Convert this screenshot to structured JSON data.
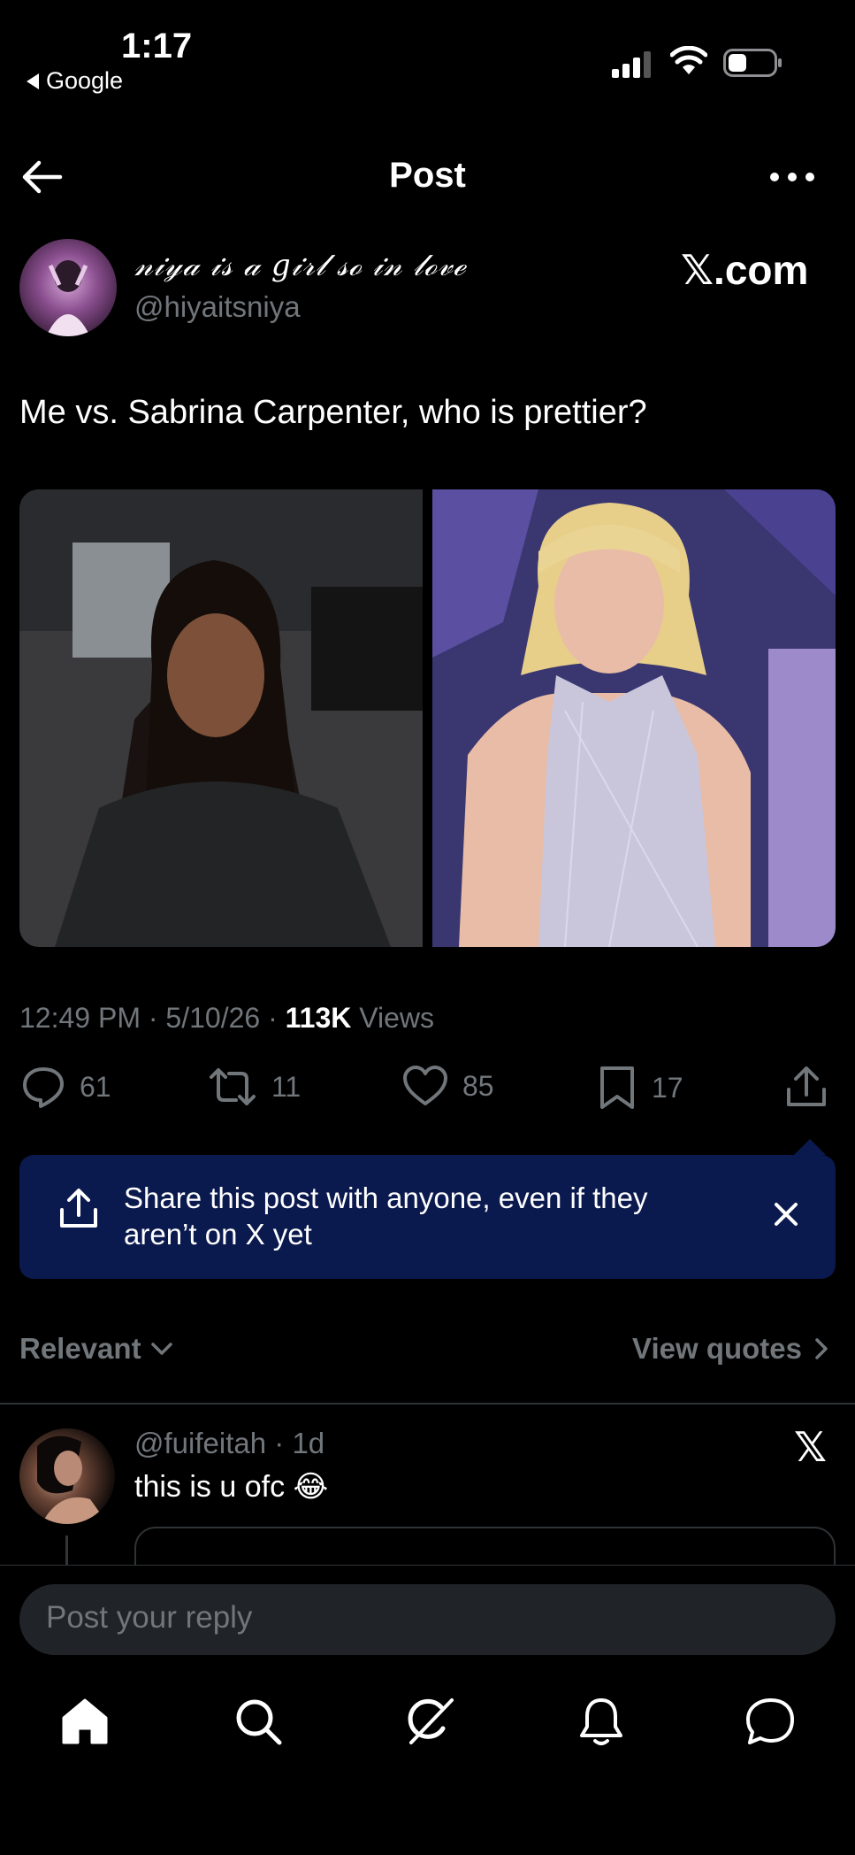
{
  "status_bar": {
    "time": "1:17",
    "back_app": "Google"
  },
  "header": {
    "title": "Post"
  },
  "author": {
    "display_name": "𝓃𝒾𝓎𝒶 𝒾𝓈 𝒶 𝑔𝒾𝓇𝓁 𝓈ℴ 𝒾𝓃 𝓁ℴ𝓋ℯ",
    "handle": "@hiyaitsniya",
    "brand_text": "𝕏.com"
  },
  "post": {
    "text": "Me vs. Sabrina Carpenter, who is prettier?",
    "time": "12:49 PM",
    "date": "5/10/26",
    "views_count": "113K",
    "views_label": "Views"
  },
  "actions": {
    "replies": "61",
    "reposts": "11",
    "likes": "85",
    "bookmarks": "17"
  },
  "share_banner": {
    "text": "Share this post with anyone, even if they aren’t on X yet"
  },
  "sort": {
    "label": "Relevant",
    "quotes_label": "View quotes"
  },
  "reply": {
    "handle": "@fuifeitah",
    "age": "1d",
    "text": "this is u ofc 😂",
    "badge": "𝕏"
  },
  "composer": {
    "placeholder": "Post your reply"
  },
  "colors": {
    "background": "#000000",
    "banner": "#0b1a4e",
    "muted": "#71767b"
  }
}
